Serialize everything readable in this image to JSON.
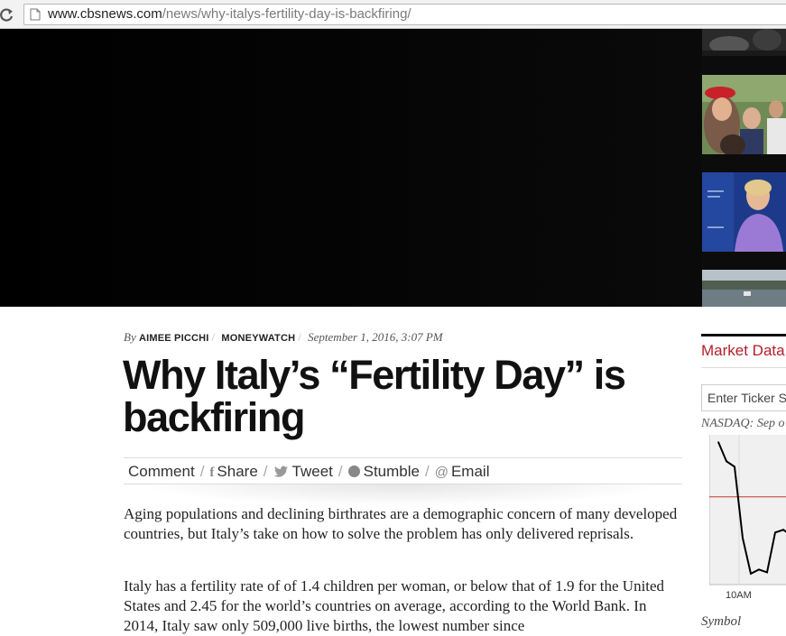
{
  "browser": {
    "url_domain": "www.cbsnews.com",
    "url_path": "/news/why-italys-fertility-day-is-backfiring/"
  },
  "article": {
    "byline_prefix": "By",
    "author": "AIMEE PICCHI",
    "section": "MONEYWATCH",
    "date": "September 1, 2016, 3:07 PM",
    "headline_line1": "Why Italy’s “Fertility Day” is",
    "headline_line2": "backfiring",
    "paragraph1": "Aging populations and declining birthrates are a demographic concern of many developed countries, but Italy’s take on how to solve the problem has only delivered reprisals.",
    "paragraph2": "Italy has a fertility rate of of 1.4 children per woman, or below that of 1.9 for the United States and 2.45 for the world’s countries on average, according to the World Bank. In 2014, Italy saw only 509,000 live births, the lowest number since"
  },
  "share": {
    "comment": "Comment",
    "share": "Share",
    "tweet": "Tweet",
    "stumble": "Stumble",
    "email": "Email",
    "icons": [
      "facebook-icon",
      "twitter-icon",
      "stumbleupon-icon",
      "at-sign-icon"
    ]
  },
  "sidebar": {
    "market_title": "Market Data",
    "ticker_placeholder": "Enter Ticker Sy",
    "index_label": "NASDAQ: Sep o",
    "chart_time_label": "10AM",
    "symbol_label": "Symbol"
  },
  "colors": {
    "accent": "#b2202a",
    "chart_line": "#000000",
    "chart_bg": "#f0f0f0",
    "reference_line": "#c0392b"
  },
  "chart_data": {
    "type": "line",
    "x_tick_labels": [
      "10AM"
    ],
    "title": "",
    "xlabel": "",
    "ylabel": "",
    "series": [
      {
        "values": [
          100,
          86,
          82,
          30,
          4,
          7,
          5,
          34,
          36,
          32
        ]
      }
    ],
    "reference_value": 60,
    "ylim": [
      0,
      100
    ],
    "grid": true
  }
}
